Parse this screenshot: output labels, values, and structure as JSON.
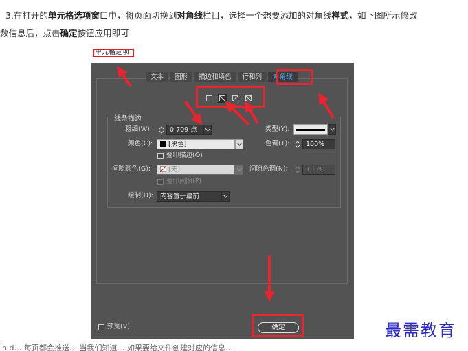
{
  "article": {
    "p1_a": "3.在打开的",
    "p1_b": "单元格选项窗",
    "p1_c": "口中，将页面切换到",
    "p1_d": "对角线",
    "p1_e": "栏目，选择一个想要添加的对角线",
    "p1_f": "样式",
    "p1_g": "，如下图所示修改",
    "p2_a": "数信息后，点击",
    "p2_b": "确定",
    "p2_c": "按钮应用即可",
    "footer": "in d…  每页都会推送… 当我们知道… 如果要给文件创建对应的信息…"
  },
  "dialog": {
    "title": "单元格选项",
    "tabs": [
      {
        "label": "文本",
        "active": false
      },
      {
        "label": "图形",
        "active": false
      },
      {
        "label": "描边和填色",
        "active": false
      },
      {
        "label": "行和列",
        "active": false
      },
      {
        "label": "对角线",
        "active": true
      }
    ],
    "diagonal_styles": [
      "none",
      "top-left-to-bottom-right",
      "bottom-left-to-top-right",
      "both"
    ],
    "selected_style": "top-left-to-bottom-right",
    "group_title": "线条描边",
    "weight": {
      "label": "粗细(W):",
      "value": "0.709 点"
    },
    "type": {
      "label": "类型(Y):"
    },
    "color": {
      "label": "颜色(C):",
      "value": "[黑色]",
      "swatch": "#000000"
    },
    "tint": {
      "label": "色调(T):",
      "value": "100%"
    },
    "overprint_stroke": "叠印描边(O)",
    "gap_color": {
      "label": "间隙颜色(G):",
      "value": "[无]"
    },
    "gap_tint": {
      "label": "间隙色调(N):",
      "value": "100%"
    },
    "overprint_gap": "叠印间隙(P)",
    "draw": {
      "label": "绘制(D):",
      "value": "内容置于最前"
    },
    "preview": "预览(V)",
    "ok": "确定"
  },
  "watermark": "最需教育",
  "colors": {
    "highlight": "#e8242f",
    "active_tab": "#4aa3ff",
    "dialog_bg": "#535353",
    "watermark": "#2c2cc0"
  }
}
